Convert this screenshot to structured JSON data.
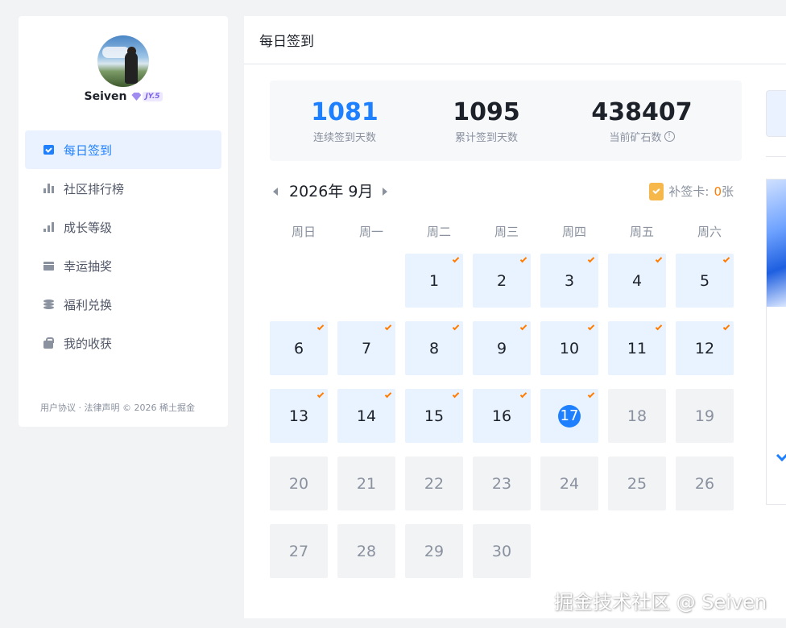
{
  "user": {
    "name": "Seiven",
    "level": "JY.5"
  },
  "nav": {
    "items": [
      {
        "label": "每日签到",
        "icon": "calendar-check-icon",
        "active": true
      },
      {
        "label": "社区排行榜",
        "icon": "bar-chart-icon",
        "active": false
      },
      {
        "label": "成长等级",
        "icon": "level-chart-icon",
        "active": false
      },
      {
        "label": "幸运抽奖",
        "icon": "gift-icon",
        "active": false
      },
      {
        "label": "福利兑换",
        "icon": "coins-icon",
        "active": false
      },
      {
        "label": "我的收获",
        "icon": "bag-icon",
        "active": false
      }
    ]
  },
  "footer": "用户协议 · 法律声明 © 2026 稀土掘金",
  "page": {
    "title": "每日签到"
  },
  "stats": {
    "consecutive": {
      "value": "1081",
      "label": "连续签到天数"
    },
    "total": {
      "value": "1095",
      "label": "累计签到天数"
    },
    "ore": {
      "value": "438407",
      "label": "当前矿石数",
      "info": "!"
    }
  },
  "calendar": {
    "title": "2026年 9月",
    "makeup_label": "补签卡:",
    "makeup_count": "0",
    "makeup_unit": "张",
    "weekdays": [
      "周日",
      "周一",
      "周二",
      "周三",
      "周四",
      "周五",
      "周六"
    ],
    "first_weekday": 2,
    "today": 17,
    "days": [
      {
        "day": "1",
        "state": "signed"
      },
      {
        "day": "2",
        "state": "signed"
      },
      {
        "day": "3",
        "state": "signed"
      },
      {
        "day": "4",
        "state": "signed"
      },
      {
        "day": "5",
        "state": "signed"
      },
      {
        "day": "6",
        "state": "signed"
      },
      {
        "day": "7",
        "state": "signed"
      },
      {
        "day": "8",
        "state": "signed"
      },
      {
        "day": "9",
        "state": "signed"
      },
      {
        "day": "10",
        "state": "signed"
      },
      {
        "day": "11",
        "state": "signed"
      },
      {
        "day": "12",
        "state": "signed"
      },
      {
        "day": "13",
        "state": "signed"
      },
      {
        "day": "14",
        "state": "signed"
      },
      {
        "day": "15",
        "state": "signed"
      },
      {
        "day": "16",
        "state": "signed"
      },
      {
        "day": "17",
        "state": "today"
      },
      {
        "day": "18",
        "state": "future"
      },
      {
        "day": "19",
        "state": "future"
      },
      {
        "day": "20",
        "state": "future"
      },
      {
        "day": "21",
        "state": "future"
      },
      {
        "day": "22",
        "state": "future"
      },
      {
        "day": "23",
        "state": "future"
      },
      {
        "day": "24",
        "state": "future"
      },
      {
        "day": "25",
        "state": "future"
      },
      {
        "day": "26",
        "state": "future"
      },
      {
        "day": "27",
        "state": "future"
      },
      {
        "day": "28",
        "state": "future"
      },
      {
        "day": "29",
        "state": "future"
      },
      {
        "day": "30",
        "state": "future"
      }
    ]
  },
  "watermark": "掘金技术社区 @ Seiven",
  "colors": {
    "accent": "#1e80ff",
    "signed_bg": "#e8f3ff",
    "future_bg": "#f2f3f5",
    "check": "#ff7d00"
  }
}
